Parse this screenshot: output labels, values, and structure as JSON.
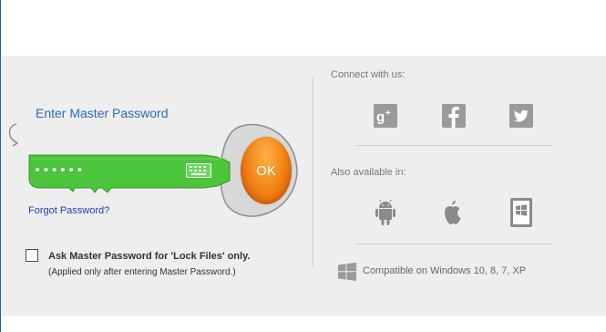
{
  "login": {
    "title": "Enter Master Password",
    "password_value": "••••••",
    "ok_label": "OK",
    "forgot_label": "Forgot Password?",
    "lock_files_label": "Ask Master Password for 'Lock Files' only.",
    "lock_files_note": "(Applied only after entering Master Password.)",
    "lock_files_checked": false
  },
  "connect": {
    "label": "Connect with us:",
    "items": [
      "google-plus-icon",
      "facebook-icon",
      "twitter-icon"
    ]
  },
  "available": {
    "label": "Also available in:",
    "items": [
      "android-icon",
      "apple-icon",
      "windows-phone-icon"
    ]
  },
  "compat": {
    "icon": "windows-icon",
    "text": "Compatible on Windows 10, 8, 7, XP"
  },
  "colors": {
    "panel_bg": "#eeeeee",
    "key_green": "#4cc43c",
    "ok_orange": "#f07a10",
    "link_blue": "#1a3fb8",
    "title_blue": "#2a6cb4",
    "social_gray": "#9a9a9a"
  }
}
